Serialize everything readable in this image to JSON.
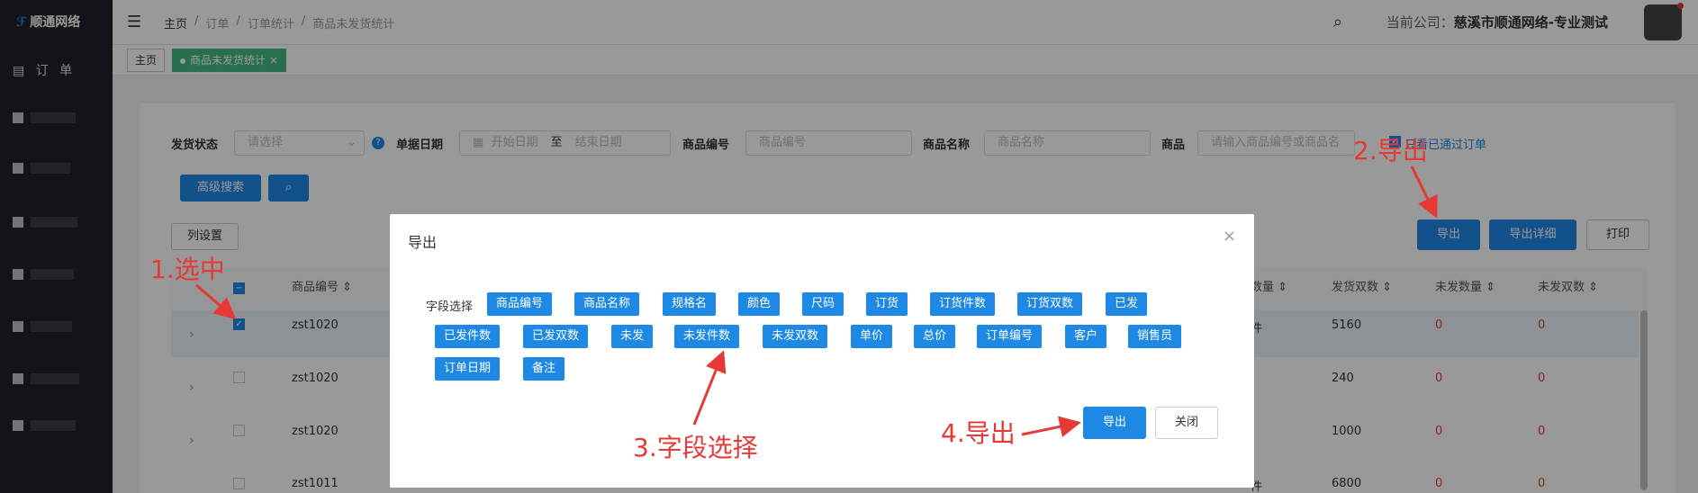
{
  "app": {
    "logo": "顺通网络",
    "nav_order": "订 单"
  },
  "header": {
    "breadcrumbs": [
      "主页",
      "/",
      "订单",
      "/",
      "订单统计",
      "/",
      "商品未发货统计"
    ],
    "company_label": "当前公司：",
    "company_name": "慈溪市顺通网络-专业测试"
  },
  "tabs": [
    {
      "label": "主页"
    },
    {
      "label": "商品未发货统计",
      "close": "×"
    }
  ],
  "filters": {
    "ship_status_label": "发货状态",
    "ship_status_placeholder": "请选择",
    "date_label": "单据日期",
    "start_placeholder": "开始日期",
    "to": "至",
    "end_placeholder": "结束日期",
    "code_label": "商品编号",
    "code_placeholder": "商品编号",
    "name_label": "商品名称",
    "name_placeholder": "商品名称",
    "goods_label": "商品",
    "goods_placeholder": "请输入商品编号或商品名",
    "view_passed": "只看已通过订单"
  },
  "toolbar": {
    "advanced_search": "高级搜索",
    "column_settings": "列设置",
    "export": "导出",
    "export_detail": "导出详细",
    "print": "打印"
  },
  "table": {
    "headers_left": [
      "商品编号"
    ],
    "headers_right": [
      "数量",
      "发货双数",
      "未发数量",
      "未发双数"
    ],
    "rows": [
      {
        "code": "zst1020",
        "ship_pairs": "5160",
        "unshipped_qty": "0",
        "unshipped_pairs": "0",
        "qty_fragment": "件"
      },
      {
        "code": "zst1020",
        "ship_pairs": "240",
        "unshipped_qty": "0",
        "unshipped_pairs": "0"
      },
      {
        "code": "zst1020",
        "ship_pairs": "1000",
        "unshipped_qty": "0",
        "unshipped_pairs": "0"
      },
      {
        "code": "zst1011",
        "ship_pairs": "6800",
        "unshipped_qty": "0",
        "unshipped_pairs": "0",
        "qty_fragment": "件"
      }
    ]
  },
  "modal": {
    "title": "导出",
    "field_label": "字段选择",
    "fields": [
      "商品编号",
      "商品名称",
      "规格名",
      "颜色",
      "尺码",
      "订货",
      "订货件数",
      "订货双数",
      "已发",
      "已发件数",
      "已发双数",
      "未发",
      "未发件数",
      "未发双数",
      "单价",
      "总价",
      "订单编号",
      "客户",
      "销售员",
      "订单日期",
      "备注"
    ],
    "export_button": "导出",
    "close_button": "关闭"
  },
  "annotations": {
    "step1": "1.选中",
    "step2": "2.导出",
    "step3": "3.字段选择",
    "step4": "4.导出"
  },
  "colors": {
    "accent": "#1e88e5",
    "annotation": "#e53935",
    "tab_active": "#42b983"
  }
}
